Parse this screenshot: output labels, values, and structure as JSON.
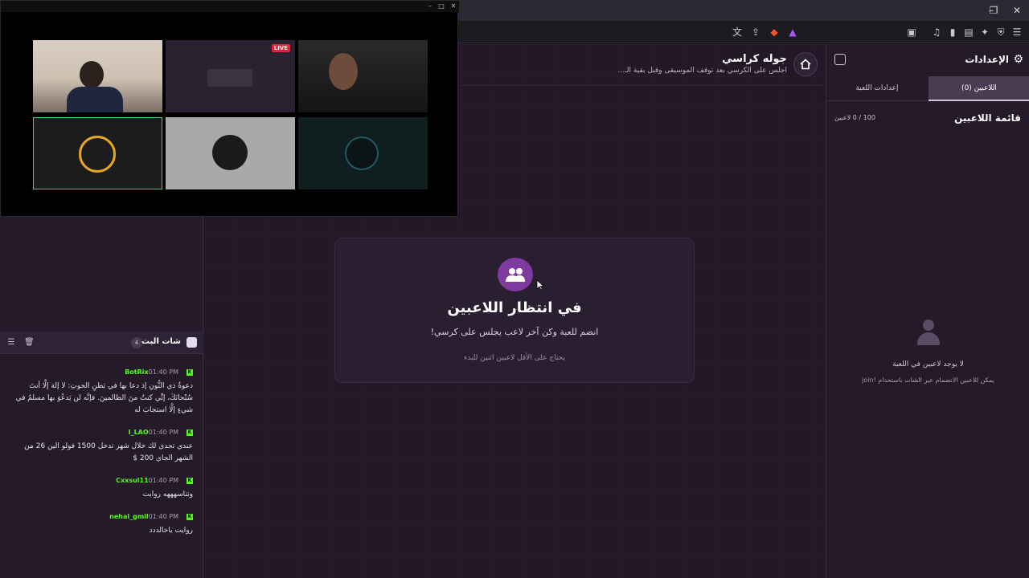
{
  "colors": {
    "accent": "#7e3a9e",
    "kick_green": "#53fc18",
    "bg": "#1f1526"
  },
  "browser": {
    "tab_icons": [
      "translate-icon",
      "share-icon",
      "brave-shield-icon",
      "brave-rewards-icon"
    ]
  },
  "video_window": {
    "live_badge": "LIVE"
  },
  "header": {
    "title": "جوله كراسي",
    "subtitle": "اجلس على الكرسي بعد توقف الموسيقى وقبل بقية الـ..."
  },
  "waiting": {
    "title": "في انتظار اللاعبين",
    "description": "انضم للعبة وكن آخر لاعب يجلس على كرسي!",
    "note": "يحتاج على الأقل لاعبين اثنين للبدء"
  },
  "settings": {
    "title": "الإعدادات",
    "tabs": [
      {
        "label": "اللاعبين (0)",
        "active": true
      },
      {
        "label": "إعدادات اللعبة",
        "active": false
      }
    ],
    "players_list_title": "قائمة اللاعبين",
    "players_count": "100 / 0 لاعبين",
    "empty_title": "لا يوجد لاعبين في اللعبة",
    "empty_desc": "يمكن للاعبين الانضمام عبر الشات باستخدام !join"
  },
  "chat": {
    "title": "شات البث",
    "count": "4",
    "messages": [
      {
        "user": "BotRix",
        "time": "01:40 PM",
        "text": "دعوةُ ذي النُّونِ إذ دعا بها في بَطنِ الحوتِ: لا إلهَ إلَّا أنتَ سُبْحانَكَ، إنِّي كنتُ منَ الظالمينَ. فإنَّه لن يَدعُوَ بها مسلمٌ في شيءٍ إلَّا استجابَ له"
      },
      {
        "user": "I_LAO",
        "time": "01:40 PM",
        "text": "عندي تحدي لك خلال شهر تدخل 1500 فولو الين 26 من الشهر الجاي 200 $"
      },
      {
        "user": "Cxxsul11",
        "time": "01:40 PM",
        "text": "وتتاسهههه روايت"
      },
      {
        "user": "nehal_gmil",
        "time": "01:40 PM",
        "text": "روايت ياخالددد"
      }
    ]
  }
}
